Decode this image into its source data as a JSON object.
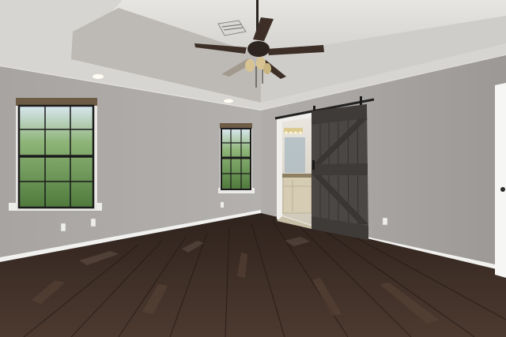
{
  "scene": {
    "kind": "photo",
    "subject": "empty-bedroom",
    "colors": {
      "wall": "#a9a6a4",
      "ceiling": "#d9d8d4",
      "floor": "#3e2f27",
      "barn_door": "#4a4644",
      "window_green": "#6f9a55",
      "baseboard": "#f2f2f0"
    }
  }
}
